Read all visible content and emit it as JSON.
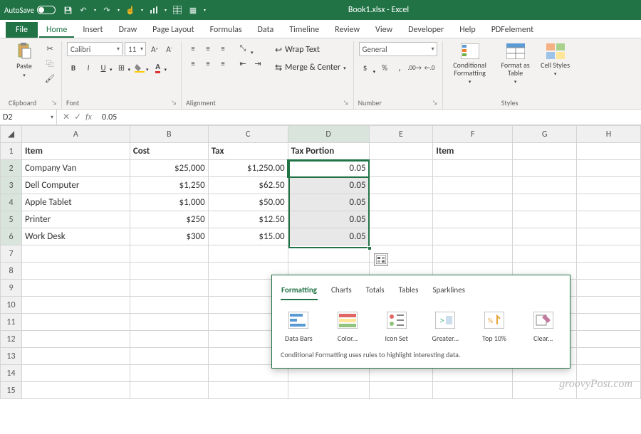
{
  "title": "Book1.xlsx - Excel",
  "autosave_label": "AutoSave",
  "menu": {
    "file": "File",
    "home": "Home",
    "insert": "Insert",
    "draw": "Draw",
    "page_layout": "Page Layout",
    "formulas": "Formulas",
    "data": "Data",
    "timeline": "Timeline",
    "review": "Review",
    "view": "View",
    "developer": "Developer",
    "help": "Help",
    "pdf": "PDFelement"
  },
  "ribbon": {
    "clipboard": {
      "label": "Clipboard",
      "paste": "Paste"
    },
    "font": {
      "label": "Font",
      "name": "Calibri",
      "size": "11",
      "bold": "B",
      "italic": "I",
      "underline": "U"
    },
    "alignment": {
      "label": "Alignment",
      "wrap": "Wrap Text",
      "merge": "Merge & Center"
    },
    "number": {
      "label": "Number",
      "format": "General"
    },
    "styles": {
      "label": "Styles",
      "cond": "Conditional Formatting",
      "table": "Format as Table",
      "cell": "Cell Styles"
    }
  },
  "namebox": "D2",
  "formula": "0.05",
  "headers": {
    "r1c1": "Item",
    "r1c2": "Cost",
    "r1c3": "Tax",
    "r1c4": "Tax Portion",
    "r1c6": "Item"
  },
  "rows": [
    {
      "item": "Company Van",
      "cost": "$25,000",
      "tax": "$1,250.00",
      "tp": "0.05"
    },
    {
      "item": "Dell Computer",
      "cost": "$1,250",
      "tax": "$62.50",
      "tp": "0.05"
    },
    {
      "item": "Apple Tablet",
      "cost": "$1,000",
      "tax": "$50.00",
      "tp": "0.05"
    },
    {
      "item": "Printer",
      "cost": "$250",
      "tax": "$12.50",
      "tp": "0.05"
    },
    {
      "item": "Work Desk",
      "cost": "$300",
      "tax": "$15.00",
      "tp": "0.05"
    }
  ],
  "qa": {
    "tabs": {
      "formatting": "Formatting",
      "charts": "Charts",
      "totals": "Totals",
      "tables": "Tables",
      "sparklines": "Sparklines"
    },
    "items": {
      "databars": "Data Bars",
      "color": "Color...",
      "iconset": "Icon Set",
      "greater": "Greater...",
      "top10": "Top 10%",
      "clear": "Clear..."
    },
    "desc": "Conditional Formatting uses rules to highlight interesting data."
  },
  "watermark": "groovyPost.com"
}
